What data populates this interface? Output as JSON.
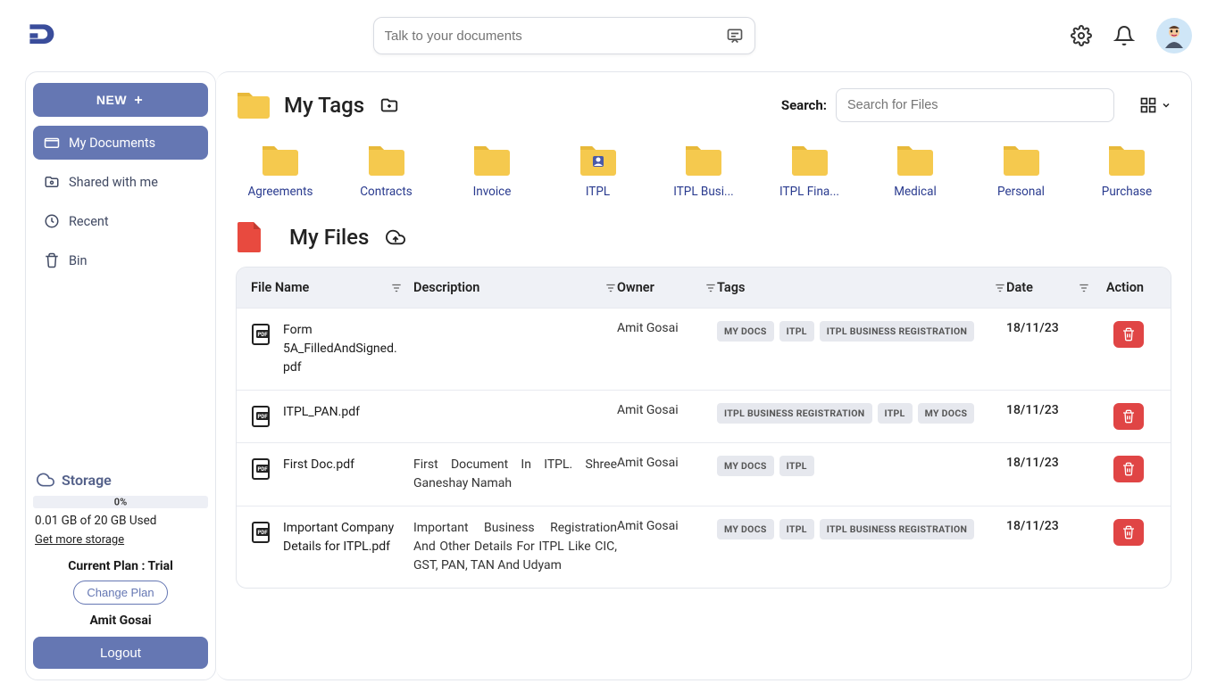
{
  "topbar": {
    "search_placeholder": "Talk to your documents"
  },
  "sidebar": {
    "new_label": "NEW",
    "nav": [
      {
        "label": "My Documents",
        "icon": "folder-icon"
      },
      {
        "label": "Shared with me",
        "icon": "share-icon"
      },
      {
        "label": "Recent",
        "icon": "clock-icon"
      },
      {
        "label": "Bin",
        "icon": "trash-icon"
      }
    ],
    "storage": {
      "title": "Storage",
      "percent": "0%",
      "used_line": "0.01 GB of 20 GB Used",
      "get_more": "Get more storage"
    },
    "plan_line": "Current Plan : Trial",
    "change_plan": "Change Plan",
    "user": "Amit Gosai",
    "logout": "Logout"
  },
  "main": {
    "tags_title": "My Tags",
    "search_label": "Search:",
    "search_placeholder": "Search for Files",
    "folders": [
      {
        "label": "Agreements",
        "special": false
      },
      {
        "label": "Contracts",
        "special": false
      },
      {
        "label": "Invoice",
        "special": false
      },
      {
        "label": "ITPL",
        "special": true
      },
      {
        "label": "ITPL Busi...",
        "special": false
      },
      {
        "label": "ITPL Fina...",
        "special": false
      },
      {
        "label": "Medical",
        "special": false
      },
      {
        "label": "Personal",
        "special": false
      },
      {
        "label": "Purchase",
        "special": false
      }
    ],
    "files_title": "My Files",
    "columns": {
      "name": "File Name",
      "description": "Description",
      "owner": "Owner",
      "tags": "Tags",
      "date": "Date",
      "action": "Action"
    },
    "rows": [
      {
        "name": "Form 5A_FilledAndSigned.pdf",
        "description": "",
        "owner": "Amit Gosai",
        "tags": [
          "MY DOCS",
          "ITPL",
          "ITPL BUSINESS REGISTRATION"
        ],
        "date": "18/11/23"
      },
      {
        "name": "ITPL_PAN.pdf",
        "description": "",
        "owner": "Amit Gosai",
        "tags": [
          "ITPL BUSINESS REGISTRATION",
          "ITPL",
          "MY DOCS"
        ],
        "date": "18/11/23"
      },
      {
        "name": "First Doc.pdf",
        "description": "First Document In ITPL. Shree Ganeshay Namah",
        "owner": "Amit Gosai",
        "tags": [
          "MY DOCS",
          "ITPL"
        ],
        "date": "18/11/23"
      },
      {
        "name": "Important Company Details for ITPL.pdf",
        "description": "Important Business Registration And Other Details For ITPL Like CIC, GST, PAN, TAN And Udyam",
        "owner": "Amit Gosai",
        "tags": [
          "MY DOCS",
          "ITPL",
          "ITPL BUSINESS REGISTRATION"
        ],
        "date": "18/11/23"
      }
    ]
  }
}
